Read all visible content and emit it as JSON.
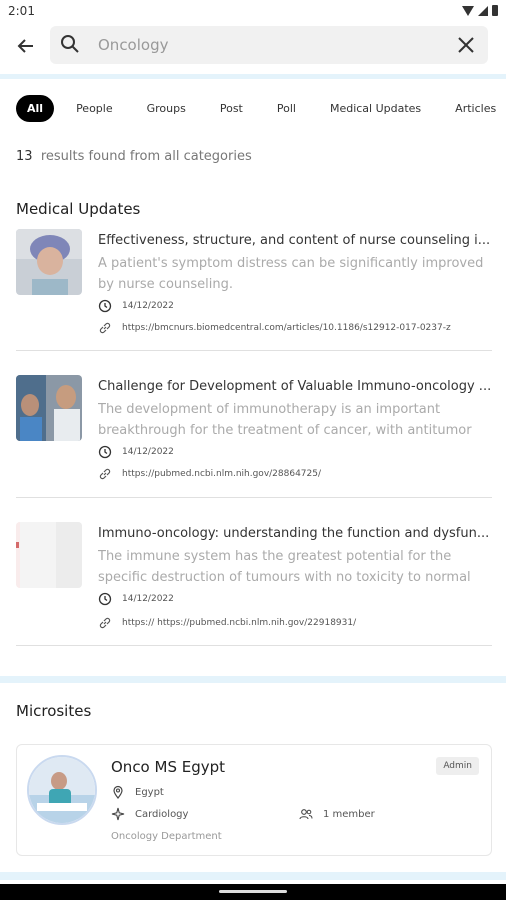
{
  "status_bar": {
    "time": "2:01"
  },
  "search": {
    "value": "Oncology",
    "placeholder": "Oncology"
  },
  "tabs": [
    "All",
    "People",
    "Groups",
    "Post",
    "Poll",
    "Medical Updates",
    "Articles"
  ],
  "results": {
    "count": "13",
    "suffix": "results found from all categories"
  },
  "medical_updates": {
    "title": "Medical Updates",
    "items": [
      {
        "title": "Effectiveness, structure, and content of nurse counseling i...",
        "description": "A patient's symptom distress can be significantly improved by nurse counseling.",
        "date": "14/12/2022",
        "link": "https://bmcnurs.biomedcentral.com/articles/10.1186/s12912-017-0237-z"
      },
      {
        "title": "Challenge for Development of Valuable Immuno-oncology ...",
        "description": "The development of immunotherapy is an important breakthrough for the treatment of cancer, with antitumor e...",
        "date": "14/12/2022",
        "link": "https://pubmed.ncbi.nlm.nih.gov/28864725/"
      },
      {
        "title": "Immuno-oncology: understanding the function and dysfun...",
        "description": "The immune system has the greatest potential for the specific destruction of tumours with no toxicity to normal tissue and ...",
        "date": "14/12/2022",
        "link": "https:// https://pubmed.ncbi.nlm.nih.gov/22918931/"
      }
    ]
  },
  "microsites": {
    "title": "Microsites",
    "card": {
      "name": "Onco MS Egypt",
      "badge": "Admin",
      "location": "Egypt",
      "specialty": "Cardiology",
      "members": "1 member",
      "department": "Oncology Department"
    }
  },
  "icons": {
    "back": "arrow-left-icon",
    "search": "search-icon",
    "clear": "close-icon",
    "date": "clock-icon",
    "link": "link-icon",
    "location": "location-pin-icon",
    "specialty": "sparkle-icon",
    "members": "people-icon"
  },
  "colors": {
    "accent_band": "#e4f3fb",
    "active_tab": "#000000"
  }
}
